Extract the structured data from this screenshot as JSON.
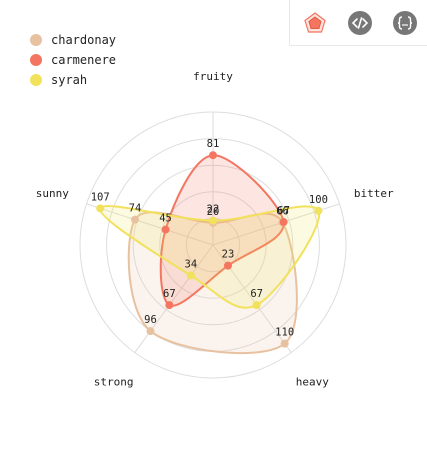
{
  "toolbar": {
    "buttons": [
      {
        "name": "radar-view",
        "icon": "radar-chart-icon"
      },
      {
        "name": "code-view",
        "icon": "code-icon"
      },
      {
        "name": "data-view",
        "icon": "json-braces-icon"
      }
    ]
  },
  "chart_data": {
    "type": "radar",
    "axes": [
      "fruity",
      "bitter",
      "heavy",
      "strong",
      "sunny"
    ],
    "max": 120,
    "levels": 5,
    "legend_position": "top-left",
    "series": [
      {
        "name": "chardonay",
        "color": "#e8c1a0",
        "values": [
          20,
          66,
          110,
          96,
          74
        ]
      },
      {
        "name": "carmenere",
        "color": "#f47560",
        "values": [
          81,
          67,
          23,
          67,
          45
        ]
      },
      {
        "name": "syrah",
        "color": "#f1e15b",
        "values": [
          22,
          100,
          67,
          34,
          107
        ]
      }
    ]
  }
}
